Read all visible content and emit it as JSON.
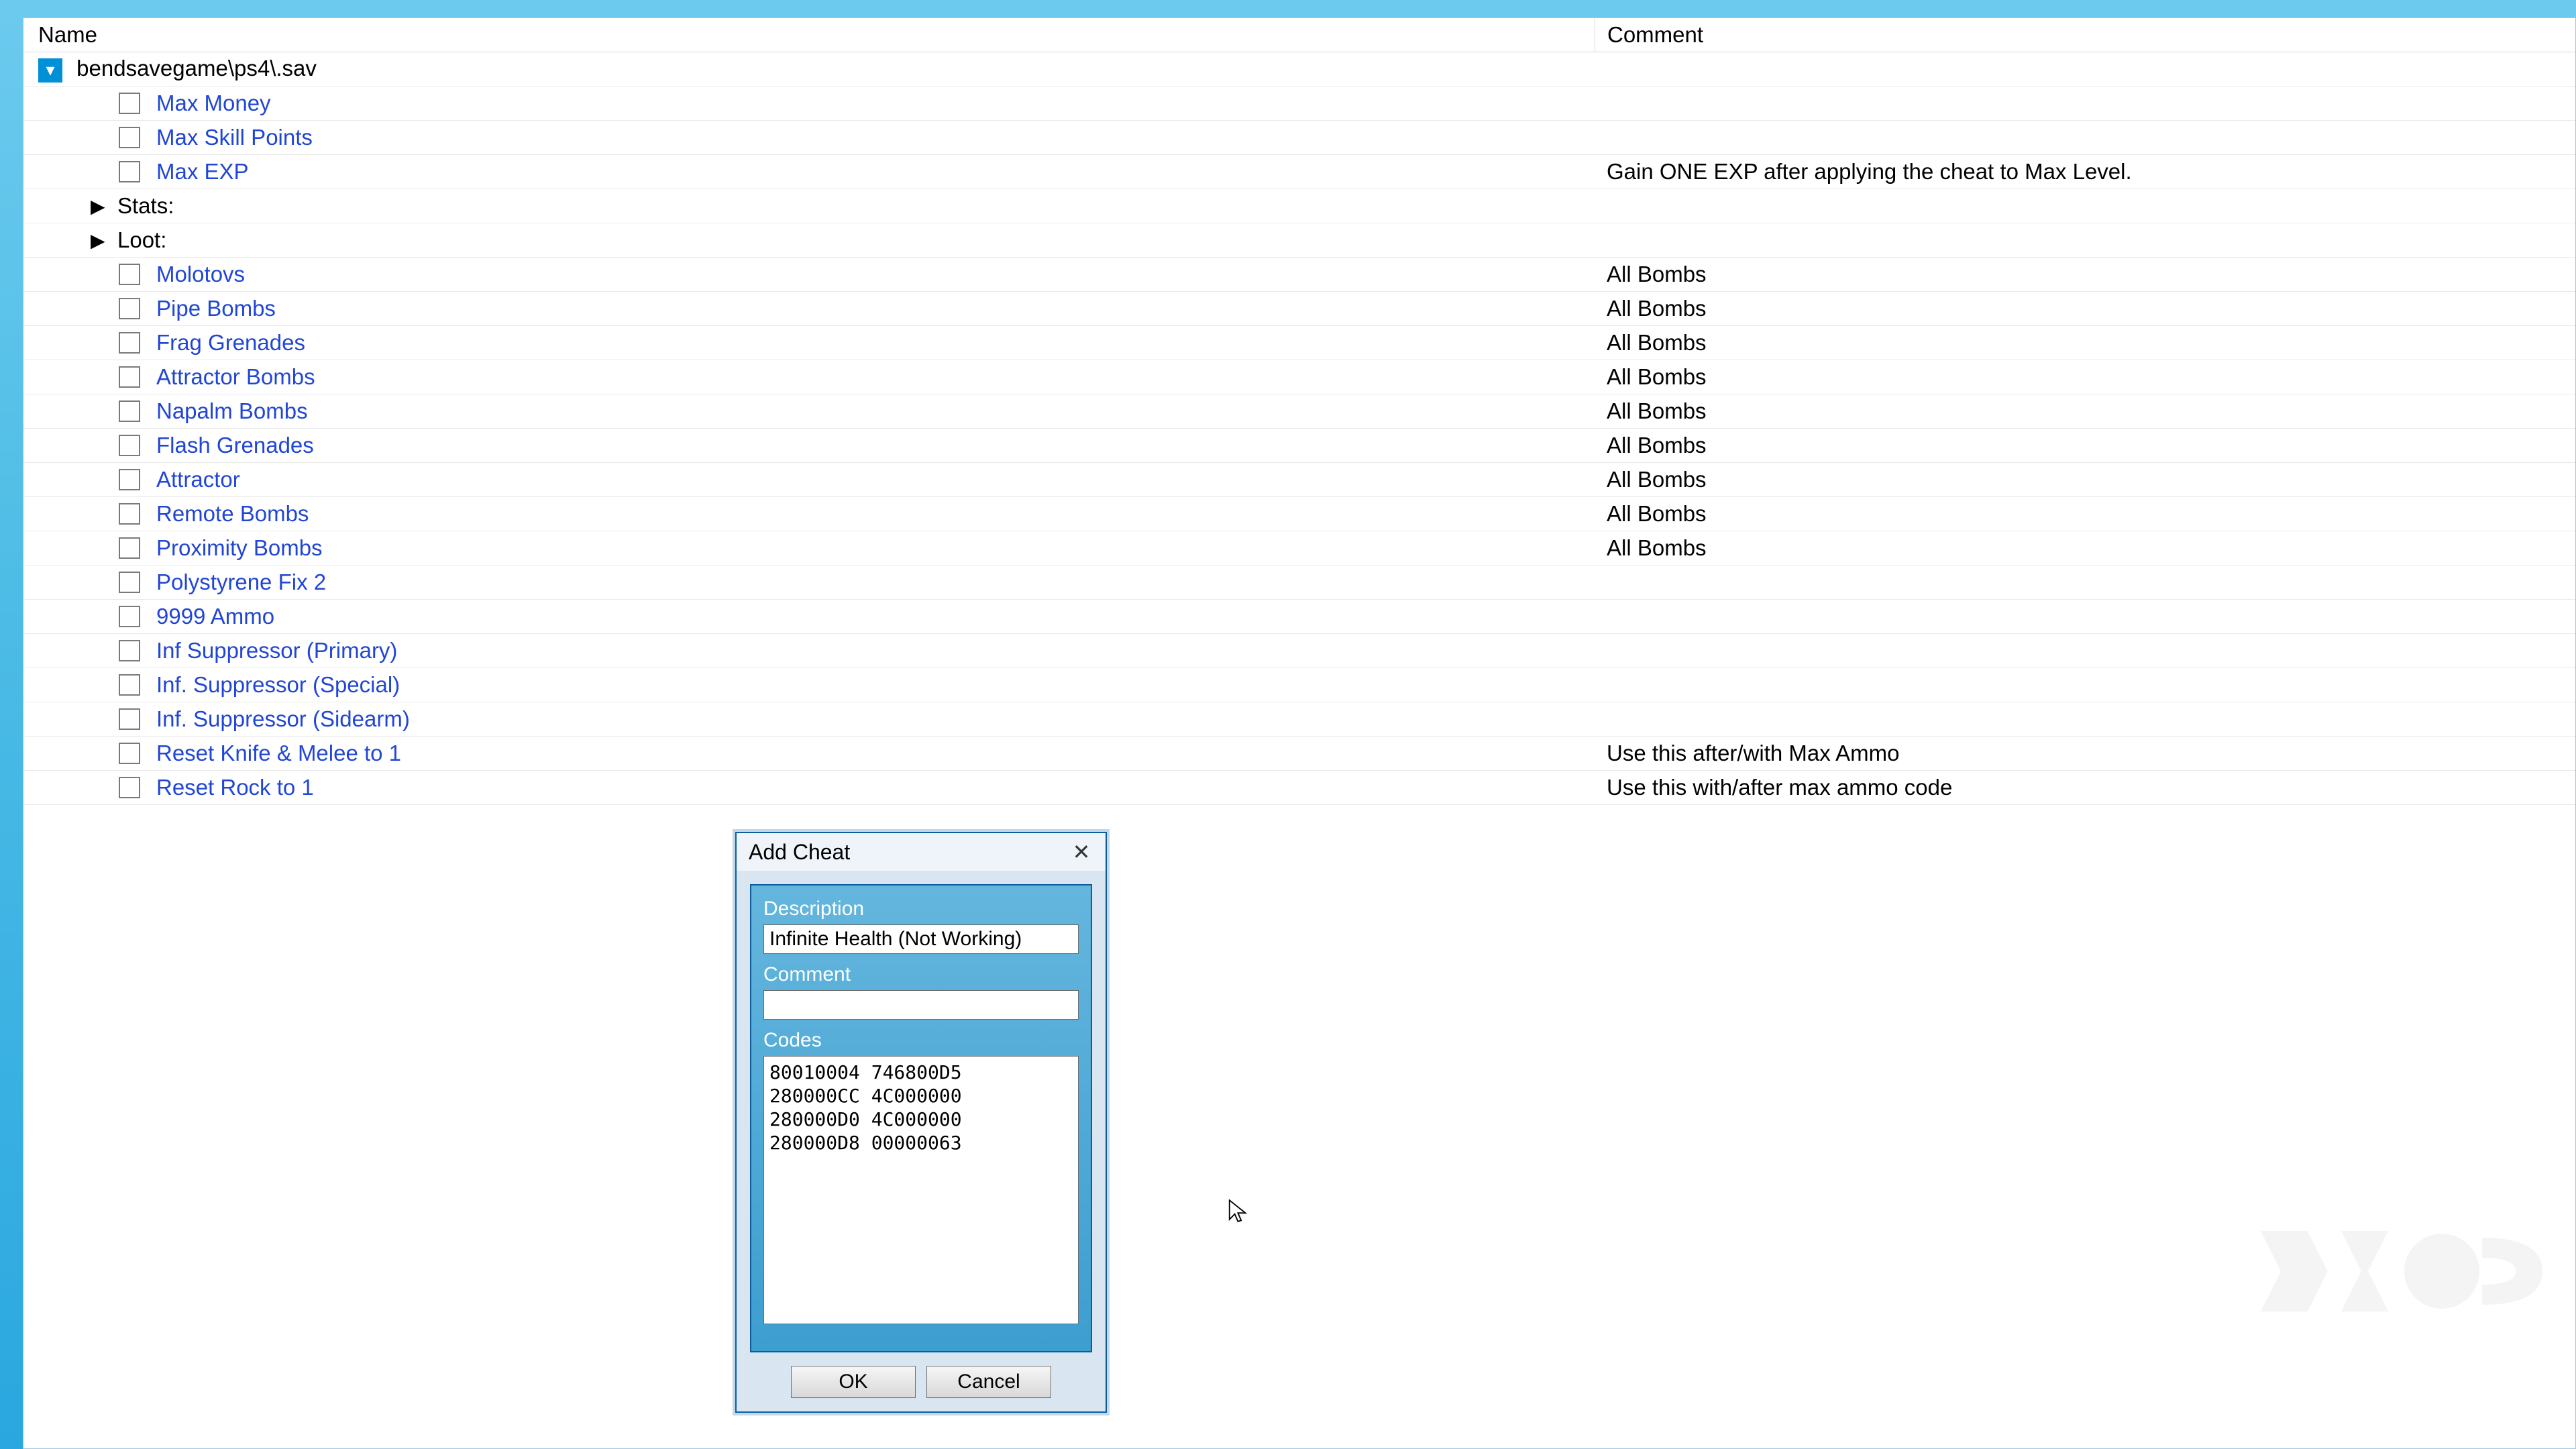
{
  "header": {
    "name": "Name",
    "comment": "Comment"
  },
  "root": {
    "label": "bendsavegame\\ps4\\.sav"
  },
  "rows": [
    {
      "kind": "leaf",
      "label": "Max Money",
      "comment": "",
      "slug": "max-money"
    },
    {
      "kind": "leaf",
      "label": "Max Skill Points",
      "comment": "",
      "slug": "max-skill-points"
    },
    {
      "kind": "leaf",
      "label": "Max EXP",
      "comment": "Gain ONE EXP after applying the cheat to Max Level.",
      "slug": "max-exp"
    },
    {
      "kind": "branch",
      "label": "Stats:",
      "slug": "stats"
    },
    {
      "kind": "branch",
      "label": "Loot:",
      "slug": "loot"
    },
    {
      "kind": "leaf",
      "label": "Molotovs",
      "comment": "All Bombs",
      "slug": "molotovs"
    },
    {
      "kind": "leaf",
      "label": "Pipe Bombs",
      "comment": "All Bombs",
      "slug": "pipe-bombs"
    },
    {
      "kind": "leaf",
      "label": "Frag Grenades",
      "comment": "All Bombs",
      "slug": "frag-grenades"
    },
    {
      "kind": "leaf",
      "label": "Attractor Bombs",
      "comment": "All Bombs",
      "slug": "attractor-bombs"
    },
    {
      "kind": "leaf",
      "label": "Napalm Bombs",
      "comment": "All Bombs",
      "slug": "napalm-bombs"
    },
    {
      "kind": "leaf",
      "label": "Flash Grenades",
      "comment": "All Bombs",
      "slug": "flash-grenades"
    },
    {
      "kind": "leaf",
      "label": "Attractor",
      "comment": "All Bombs",
      "slug": "attractor"
    },
    {
      "kind": "leaf",
      "label": "Remote Bombs",
      "comment": "All Bombs",
      "slug": "remote-bombs"
    },
    {
      "kind": "leaf",
      "label": "Proximity Bombs",
      "comment": "All Bombs",
      "slug": "proximity-bombs"
    },
    {
      "kind": "leaf",
      "label": "Polystyrene Fix 2",
      "comment": "",
      "slug": "polystyrene-fix-2"
    },
    {
      "kind": "leaf",
      "label": "9999 Ammo",
      "comment": "",
      "slug": "9999-ammo"
    },
    {
      "kind": "leaf",
      "label": "Inf Suppressor (Primary)",
      "comment": "",
      "slug": "inf-suppressor-primary"
    },
    {
      "kind": "leaf",
      "label": "Inf. Suppressor (Special)",
      "comment": "",
      "slug": "inf-suppressor-special"
    },
    {
      "kind": "leaf",
      "label": "Inf. Suppressor (Sidearm)",
      "comment": "",
      "slug": "inf-suppressor-sidearm"
    },
    {
      "kind": "leaf",
      "label": "Reset Knife & Melee to 1",
      "comment": "Use this after/with Max Ammo",
      "slug": "reset-knife-melee"
    },
    {
      "kind": "leaf",
      "label": "Reset Rock to 1",
      "comment": "Use this with/after max ammo code",
      "slug": "reset-rock"
    }
  ],
  "dialog": {
    "title": "Add Cheat",
    "description_label": "Description",
    "description_value": "Infinite Health (Not Working)",
    "comment_label": "Comment",
    "comment_value": "",
    "codes_label": "Codes",
    "codes_value": "80010004 746800D5\n280000CC 4C000000\n280000D0 4C000000\n280000D8 00000063",
    "ok": "OK",
    "cancel": "Cancel"
  }
}
